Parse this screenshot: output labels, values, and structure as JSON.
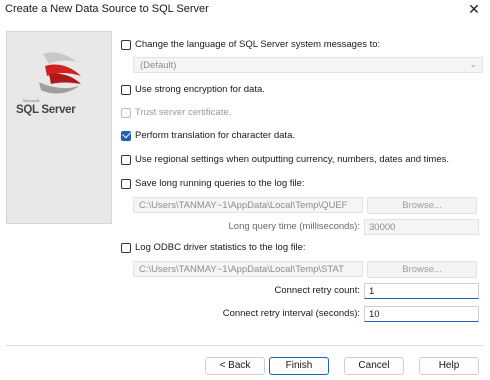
{
  "window": {
    "title": "Create a New Data Source to SQL Server",
    "close_glyph": "✕"
  },
  "sidebar": {
    "logo_text": "SQL Server",
    "logo_icon": "sql-server-logo-icon"
  },
  "options": {
    "change_language": {
      "label": "Change the language of SQL Server system messages to:",
      "checked": false
    },
    "language_dropdown": {
      "value": "(Default)",
      "chevron": "⌄"
    },
    "strong_encryption": {
      "label": "Use strong encryption for data.",
      "checked": false
    },
    "trust_certificate": {
      "label": "Trust server certificate.",
      "checked": false,
      "disabled": true
    },
    "perform_translation": {
      "label": "Perform translation for character data.",
      "checked": true
    },
    "regional_settings": {
      "label": "Use regional settings when outputting currency, numbers, dates and times.",
      "checked": false
    },
    "save_long_queries": {
      "label": "Save long running queries to the log file:",
      "checked": false
    },
    "long_query_path": "C:\\Users\\TANMAY~1\\AppData\\Local\\Temp\\QUEF",
    "long_query_browse": "Browse...",
    "long_query_time_label": "Long query time (milliseconds):",
    "long_query_time_value": "30000",
    "log_odbc_stats": {
      "label": "Log ODBC driver statistics to the log file:",
      "checked": false
    },
    "stats_path": "C:\\Users\\TANMAY~1\\AppData\\Local\\Temp\\STAT",
    "stats_browse": "Browse...",
    "connect_retry_count_label": "Connect retry count:",
    "connect_retry_count_value": "1",
    "connect_retry_interval_label": "Connect retry interval (seconds):",
    "connect_retry_interval_value": "10"
  },
  "buttons": {
    "back": "< Back",
    "finish": "Finish",
    "cancel": "Cancel",
    "help": "Help"
  },
  "colors": {
    "accent": "#1f5fb5",
    "sidebar_bg": "#e8e8e8"
  }
}
